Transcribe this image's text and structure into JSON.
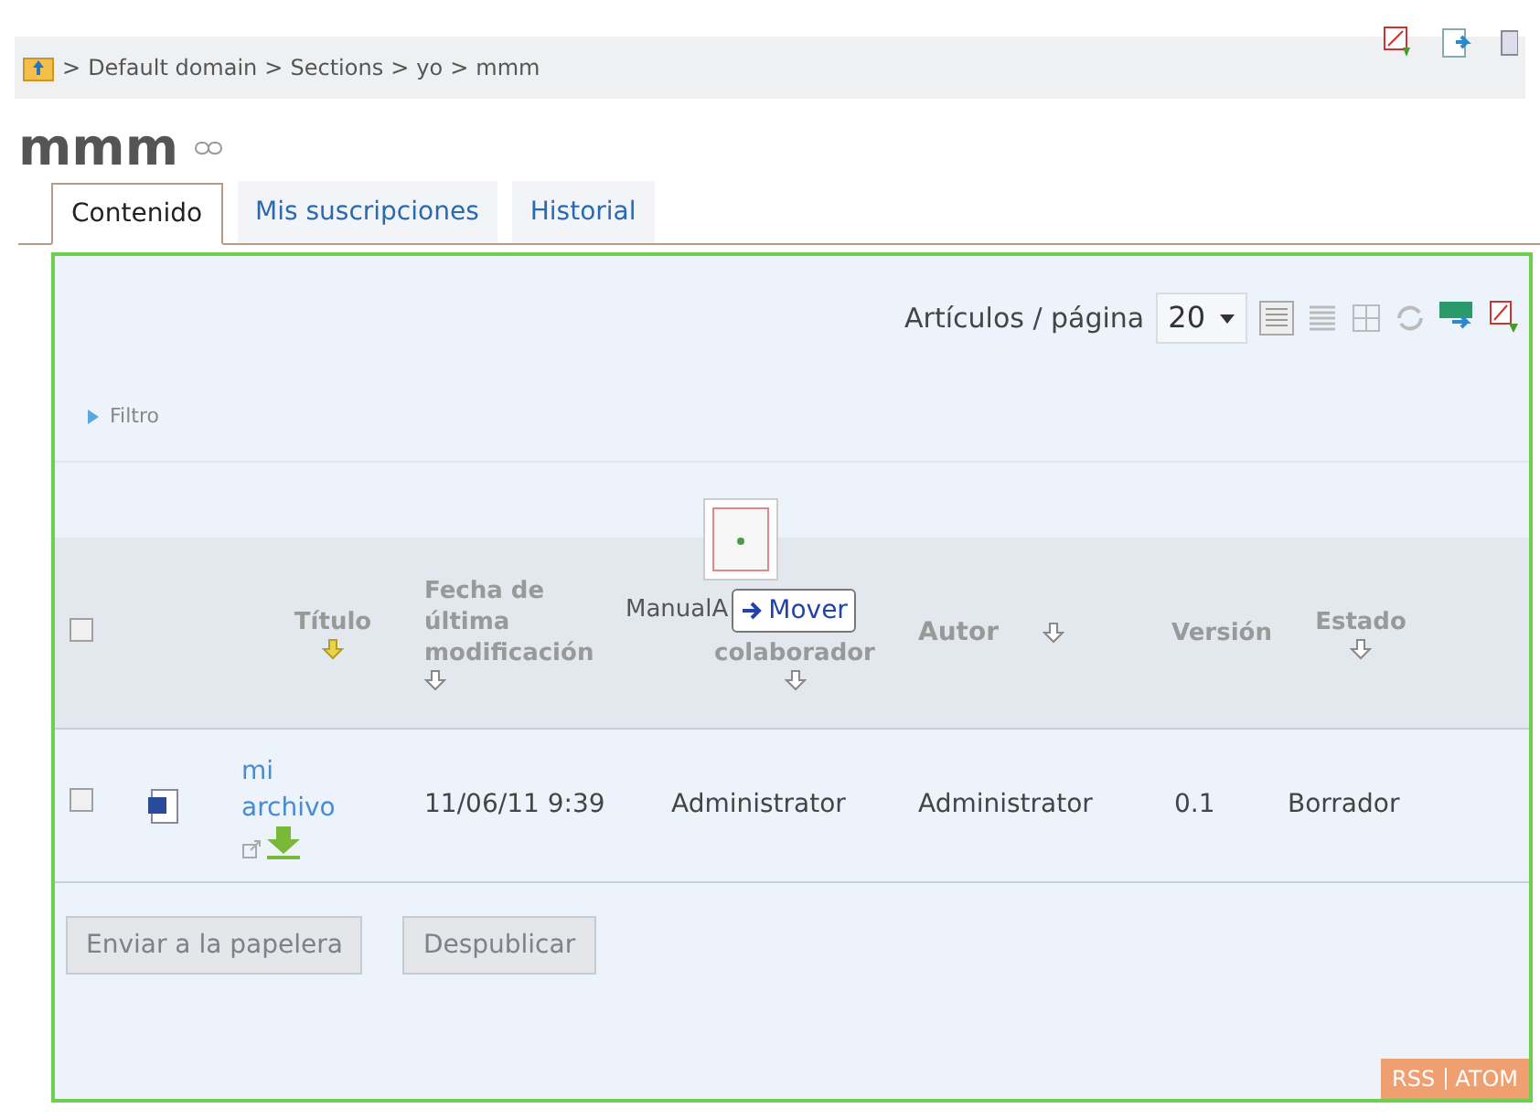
{
  "breadcrumb": {
    "items": [
      "Default domain",
      "Sections",
      "yo",
      "mmm"
    ],
    "separator": ">"
  },
  "title": "mmm",
  "tabs": [
    {
      "label": "Contenido",
      "selected": true
    },
    {
      "label": "Mis suscripciones",
      "selected": false
    },
    {
      "label": "Historial",
      "selected": false
    }
  ],
  "toolbar": {
    "per_page_label": "Artículos / página",
    "per_page_value": "20"
  },
  "filter": {
    "label": "Filtro",
    "expanded": false
  },
  "drag": {
    "ghost_label": "ManualA",
    "action": "Mover"
  },
  "table": {
    "columns": [
      {
        "label": "Título",
        "sorted": true
      },
      {
        "label": "Fecha de última modificación",
        "sorted": false
      },
      {
        "label": "colaborador",
        "sorted": false
      },
      {
        "label": "Autor",
        "sorted": false
      },
      {
        "label": "Versión"
      },
      {
        "label": "Estado",
        "sorted": false
      }
    ],
    "header_checked": false,
    "rows": [
      {
        "checked": false,
        "title": "mi archivo",
        "modified": "11/06/11 9:39",
        "contributor": "Administrator",
        "author": "Administrator",
        "version": "0.1",
        "state": "Borrador"
      }
    ]
  },
  "buttons": [
    {
      "label": "Enviar a la papelera",
      "disabled": true
    },
    {
      "label": "Despublicar",
      "disabled": true
    }
  ],
  "feeds": [
    "RSS",
    "ATOM"
  ]
}
